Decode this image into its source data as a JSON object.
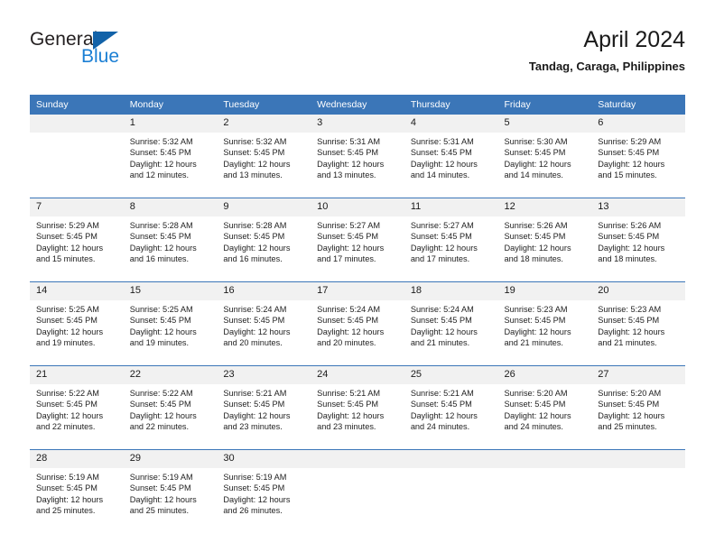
{
  "brand": {
    "name_part1": "General",
    "name_part2": "Blue"
  },
  "header": {
    "title": "April 2024",
    "subtitle": "Tandag, Caraga, Philippines"
  },
  "colors": {
    "header_blue": "#3b76b8",
    "logo_blue": "#1b7fd4",
    "logo_triangle": "#1262a8",
    "daynum_band": "#f1f1f1"
  },
  "weekdays": [
    "Sunday",
    "Monday",
    "Tuesday",
    "Wednesday",
    "Thursday",
    "Friday",
    "Saturday"
  ],
  "labels": {
    "sunrise": "Sunrise:",
    "sunset": "Sunset:",
    "daylight": "Daylight:"
  },
  "weeks": [
    [
      {
        "day": "",
        "blank": true
      },
      {
        "day": "1",
        "sunrise": "Sunrise: 5:32 AM",
        "sunset": "Sunset: 5:45 PM",
        "daylight_line1": "Daylight: 12 hours",
        "daylight_line2": "and 12 minutes."
      },
      {
        "day": "2",
        "sunrise": "Sunrise: 5:32 AM",
        "sunset": "Sunset: 5:45 PM",
        "daylight_line1": "Daylight: 12 hours",
        "daylight_line2": "and 13 minutes."
      },
      {
        "day": "3",
        "sunrise": "Sunrise: 5:31 AM",
        "sunset": "Sunset: 5:45 PM",
        "daylight_line1": "Daylight: 12 hours",
        "daylight_line2": "and 13 minutes."
      },
      {
        "day": "4",
        "sunrise": "Sunrise: 5:31 AM",
        "sunset": "Sunset: 5:45 PM",
        "daylight_line1": "Daylight: 12 hours",
        "daylight_line2": "and 14 minutes."
      },
      {
        "day": "5",
        "sunrise": "Sunrise: 5:30 AM",
        "sunset": "Sunset: 5:45 PM",
        "daylight_line1": "Daylight: 12 hours",
        "daylight_line2": "and 14 minutes."
      },
      {
        "day": "6",
        "sunrise": "Sunrise: 5:29 AM",
        "sunset": "Sunset: 5:45 PM",
        "daylight_line1": "Daylight: 12 hours",
        "daylight_line2": "and 15 minutes."
      }
    ],
    [
      {
        "day": "7",
        "sunrise": "Sunrise: 5:29 AM",
        "sunset": "Sunset: 5:45 PM",
        "daylight_line1": "Daylight: 12 hours",
        "daylight_line2": "and 15 minutes."
      },
      {
        "day": "8",
        "sunrise": "Sunrise: 5:28 AM",
        "sunset": "Sunset: 5:45 PM",
        "daylight_line1": "Daylight: 12 hours",
        "daylight_line2": "and 16 minutes."
      },
      {
        "day": "9",
        "sunrise": "Sunrise: 5:28 AM",
        "sunset": "Sunset: 5:45 PM",
        "daylight_line1": "Daylight: 12 hours",
        "daylight_line2": "and 16 minutes."
      },
      {
        "day": "10",
        "sunrise": "Sunrise: 5:27 AM",
        "sunset": "Sunset: 5:45 PM",
        "daylight_line1": "Daylight: 12 hours",
        "daylight_line2": "and 17 minutes."
      },
      {
        "day": "11",
        "sunrise": "Sunrise: 5:27 AM",
        "sunset": "Sunset: 5:45 PM",
        "daylight_line1": "Daylight: 12 hours",
        "daylight_line2": "and 17 minutes."
      },
      {
        "day": "12",
        "sunrise": "Sunrise: 5:26 AM",
        "sunset": "Sunset: 5:45 PM",
        "daylight_line1": "Daylight: 12 hours",
        "daylight_line2": "and 18 minutes."
      },
      {
        "day": "13",
        "sunrise": "Sunrise: 5:26 AM",
        "sunset": "Sunset: 5:45 PM",
        "daylight_line1": "Daylight: 12 hours",
        "daylight_line2": "and 18 minutes."
      }
    ],
    [
      {
        "day": "14",
        "sunrise": "Sunrise: 5:25 AM",
        "sunset": "Sunset: 5:45 PM",
        "daylight_line1": "Daylight: 12 hours",
        "daylight_line2": "and 19 minutes."
      },
      {
        "day": "15",
        "sunrise": "Sunrise: 5:25 AM",
        "sunset": "Sunset: 5:45 PM",
        "daylight_line1": "Daylight: 12 hours",
        "daylight_line2": "and 19 minutes."
      },
      {
        "day": "16",
        "sunrise": "Sunrise: 5:24 AM",
        "sunset": "Sunset: 5:45 PM",
        "daylight_line1": "Daylight: 12 hours",
        "daylight_line2": "and 20 minutes."
      },
      {
        "day": "17",
        "sunrise": "Sunrise: 5:24 AM",
        "sunset": "Sunset: 5:45 PM",
        "daylight_line1": "Daylight: 12 hours",
        "daylight_line2": "and 20 minutes."
      },
      {
        "day": "18",
        "sunrise": "Sunrise: 5:24 AM",
        "sunset": "Sunset: 5:45 PM",
        "daylight_line1": "Daylight: 12 hours",
        "daylight_line2": "and 21 minutes."
      },
      {
        "day": "19",
        "sunrise": "Sunrise: 5:23 AM",
        "sunset": "Sunset: 5:45 PM",
        "daylight_line1": "Daylight: 12 hours",
        "daylight_line2": "and 21 minutes."
      },
      {
        "day": "20",
        "sunrise": "Sunrise: 5:23 AM",
        "sunset": "Sunset: 5:45 PM",
        "daylight_line1": "Daylight: 12 hours",
        "daylight_line2": "and 21 minutes."
      }
    ],
    [
      {
        "day": "21",
        "sunrise": "Sunrise: 5:22 AM",
        "sunset": "Sunset: 5:45 PM",
        "daylight_line1": "Daylight: 12 hours",
        "daylight_line2": "and 22 minutes."
      },
      {
        "day": "22",
        "sunrise": "Sunrise: 5:22 AM",
        "sunset": "Sunset: 5:45 PM",
        "daylight_line1": "Daylight: 12 hours",
        "daylight_line2": "and 22 minutes."
      },
      {
        "day": "23",
        "sunrise": "Sunrise: 5:21 AM",
        "sunset": "Sunset: 5:45 PM",
        "daylight_line1": "Daylight: 12 hours",
        "daylight_line2": "and 23 minutes."
      },
      {
        "day": "24",
        "sunrise": "Sunrise: 5:21 AM",
        "sunset": "Sunset: 5:45 PM",
        "daylight_line1": "Daylight: 12 hours",
        "daylight_line2": "and 23 minutes."
      },
      {
        "day": "25",
        "sunrise": "Sunrise: 5:21 AM",
        "sunset": "Sunset: 5:45 PM",
        "daylight_line1": "Daylight: 12 hours",
        "daylight_line2": "and 24 minutes."
      },
      {
        "day": "26",
        "sunrise": "Sunrise: 5:20 AM",
        "sunset": "Sunset: 5:45 PM",
        "daylight_line1": "Daylight: 12 hours",
        "daylight_line2": "and 24 minutes."
      },
      {
        "day": "27",
        "sunrise": "Sunrise: 5:20 AM",
        "sunset": "Sunset: 5:45 PM",
        "daylight_line1": "Daylight: 12 hours",
        "daylight_line2": "and 25 minutes."
      }
    ],
    [
      {
        "day": "28",
        "sunrise": "Sunrise: 5:19 AM",
        "sunset": "Sunset: 5:45 PM",
        "daylight_line1": "Daylight: 12 hours",
        "daylight_line2": "and 25 minutes."
      },
      {
        "day": "29",
        "sunrise": "Sunrise: 5:19 AM",
        "sunset": "Sunset: 5:45 PM",
        "daylight_line1": "Daylight: 12 hours",
        "daylight_line2": "and 25 minutes."
      },
      {
        "day": "30",
        "sunrise": "Sunrise: 5:19 AM",
        "sunset": "Sunset: 5:45 PM",
        "daylight_line1": "Daylight: 12 hours",
        "daylight_line2": "and 26 minutes."
      },
      {
        "day": "",
        "blank": true
      },
      {
        "day": "",
        "blank": true
      },
      {
        "day": "",
        "blank": true
      },
      {
        "day": "",
        "blank": true
      }
    ]
  ]
}
